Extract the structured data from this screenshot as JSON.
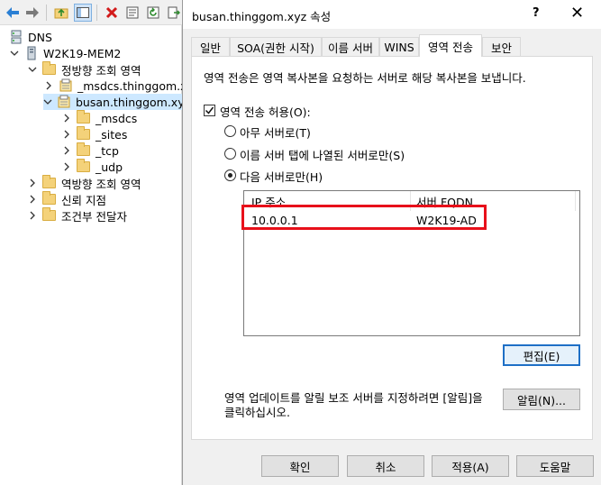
{
  "tree": {
    "root": "DNS",
    "server": "W2K19-MEM2",
    "forward_zones": "정방향 조회 영역",
    "zone_msdcs": "_msdcs.thinggom.xyz",
    "zone_busan": "busan.thinggom.xyz",
    "sub_msdcs": "_msdcs",
    "sub_sites": "_sites",
    "sub_tcp": "_tcp",
    "sub_udp": "_udp",
    "reverse_zones": "역방향 조회 영역",
    "trust_points": "신뢰 지점",
    "conditional_forwarders": "조건부 전달자"
  },
  "dialog": {
    "title": "busan.thinggom.xyz 속성",
    "help": "?",
    "close": "✕"
  },
  "tabs": [
    "일반",
    "SOA(권한 시작)",
    "이름 서버",
    "WINS",
    "영역 전송",
    "보안"
  ],
  "zone_transfer": {
    "description": "영역 전송은 영역 복사본을 요청하는 서버로 해당 복사본을 보냅니다.",
    "allow_label": "영역 전송 허용(O):",
    "allow_checked": true,
    "option_any": "아무 서버로(T)",
    "option_ns_tab": "이름 서버 탭에 나열된 서버로만(S)",
    "option_following": "다음 서버로만(H)",
    "selected_option": "following",
    "columns": [
      "IP 주소",
      "서버 FQDN"
    ],
    "rows": [
      {
        "ip": "10.0.0.1",
        "fqdn": "W2K19-AD"
      }
    ],
    "edit_button": "편집(E)",
    "notify_text_line1": "영역 업데이트를 알릴 보조 서버를 지정하려면 [알림]을",
    "notify_text_line2": "클릭하십시오.",
    "notify_button": "알림(N)..."
  },
  "footer": {
    "ok": "확인",
    "cancel": "취소",
    "apply": "적용(A)",
    "help": "도움말"
  },
  "colors": {
    "highlight": "#e8101a",
    "selection": "#cde8ff",
    "default_button_border": "#1e6fc6"
  }
}
